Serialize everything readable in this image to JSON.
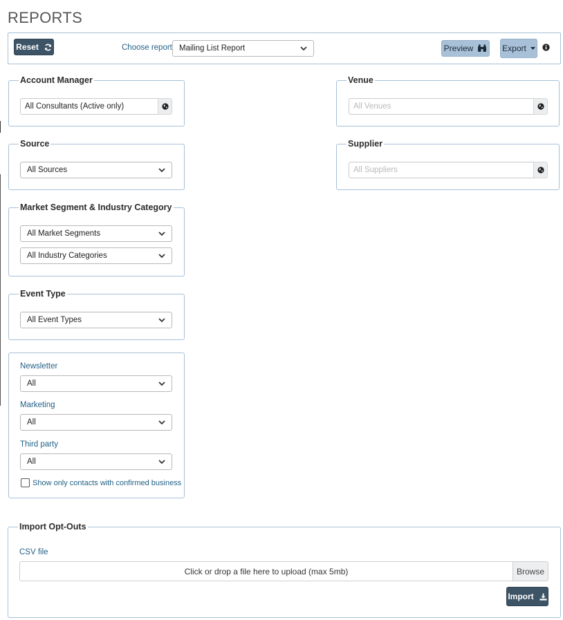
{
  "page": {
    "title": "REPORTS"
  },
  "toolbar": {
    "reset_label": "Reset",
    "choose_report_label": "Choose report",
    "report_selected": "Mailing List Report",
    "preview_label": "Preview",
    "export_label": "Export"
  },
  "account_manager": {
    "legend": "Account Manager",
    "value": "All Consultants (Active only)"
  },
  "venue": {
    "legend": "Venue",
    "placeholder": "All Venues"
  },
  "source": {
    "legend": "Source",
    "selected": "All Sources"
  },
  "supplier": {
    "legend": "Supplier",
    "placeholder": "All Suppliers"
  },
  "market_segment": {
    "legend": "Market Segment & Industry Category",
    "segment_selected": "All Market Segments",
    "category_selected": "All Industry Categories"
  },
  "event_type": {
    "legend": "Event Type",
    "selected": "All Event Types"
  },
  "preferences": {
    "newsletter_label": "Newsletter",
    "newsletter_selected": "All",
    "marketing_label": "Marketing",
    "marketing_selected": "All",
    "third_party_label": "Third party",
    "third_party_selected": "All",
    "confirmed_label": "Show only contacts with confirmed business",
    "confirmed_checked": false
  },
  "import_optouts": {
    "legend": "Import Opt-Outs",
    "csv_label": "CSV file",
    "dropzone_text": "Click or drop a file here to upload (max 5mb)",
    "browse_label": "Browse",
    "import_label": "Import"
  },
  "colors": {
    "dark_button": "#3d5466",
    "light_button": "#a9c1d8",
    "panel_border": "#a7c0d8",
    "label_blue": "#1f5f85"
  }
}
